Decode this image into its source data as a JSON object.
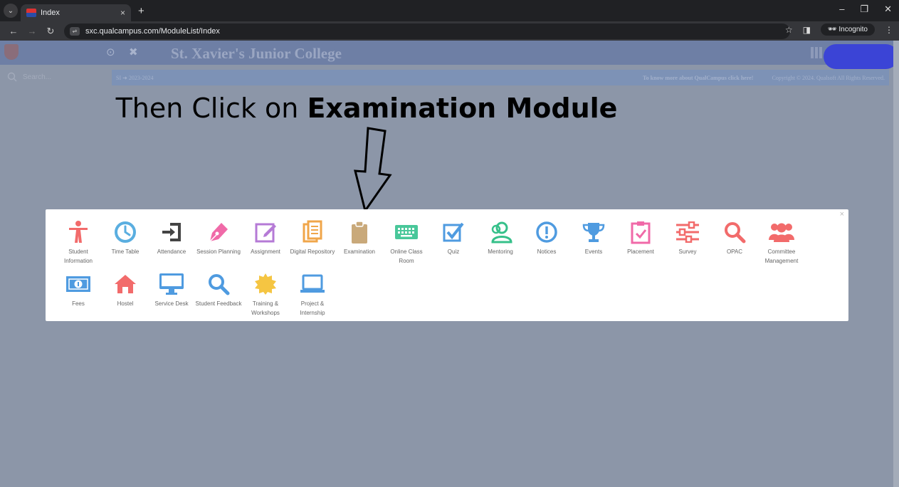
{
  "browser": {
    "tab_title": "Index",
    "tab_close": "×",
    "new_tab": "+",
    "url": "sxc.qualcampus.com/ModuleList/Index",
    "incognito_label": "Incognito",
    "controls": {
      "minimize": "–",
      "restore": "❐",
      "close": "✕"
    }
  },
  "app": {
    "college_name": "St. Xavier's Junior College",
    "search_placeholder": "Search...",
    "info_left": "SI ➜ 2023-2024",
    "info_mid": "To know more about QualCampus click here!",
    "info_right": "Copyright © 2024. Qualsoft All Rights Reserved."
  },
  "instruction": {
    "prefix": "Then Click on ",
    "emphasis": "Examination Module"
  },
  "modal": {
    "close_label": "×",
    "modules": [
      {
        "label": "Student Information",
        "icon": "person-icon",
        "color": "#f26b6b"
      },
      {
        "label": "Time Table",
        "icon": "clock-icon",
        "color": "#5aaee0"
      },
      {
        "label": "Attendance",
        "icon": "door-enter-icon",
        "color": "#444444"
      },
      {
        "label": "Session Planning",
        "icon": "pen-nib-icon",
        "color": "#f06aa8"
      },
      {
        "label": "Assignment",
        "icon": "edit-square-icon",
        "color": "#b57ad6"
      },
      {
        "label": "Digital Repository",
        "icon": "documents-icon",
        "color": "#f0a64a"
      },
      {
        "label": "Examination",
        "icon": "clipboard-icon",
        "color": "#c9a97a"
      },
      {
        "label": "Online Class Room",
        "icon": "keyboard-icon",
        "color": "#49c79a"
      },
      {
        "label": "Quiz",
        "icon": "checkbox-icon",
        "color": "#4f9be0"
      },
      {
        "label": "Mentoring",
        "icon": "people-outline-icon",
        "color": "#36c08a"
      },
      {
        "label": "Notices",
        "icon": "exclamation-circle-icon",
        "color": "#4f9be0"
      },
      {
        "label": "Events",
        "icon": "trophy-icon",
        "color": "#4f9be0"
      },
      {
        "label": "Placement",
        "icon": "clipboard-check-icon",
        "color": "#f06aa8"
      },
      {
        "label": "Survey",
        "icon": "sliders-icon",
        "color": "#f26b6b"
      },
      {
        "label": "OPAC",
        "icon": "search-icon",
        "color": "#f26b6b"
      },
      {
        "label": "Committee Management",
        "icon": "group-icon",
        "color": "#f26b6b"
      },
      {
        "label": "Fees",
        "icon": "money-icon",
        "color": "#4f9be0"
      },
      {
        "label": "Hostel",
        "icon": "home-icon",
        "color": "#f26b6b"
      },
      {
        "label": "Service Desk",
        "icon": "monitor-icon",
        "color": "#4f9be0"
      },
      {
        "label": "Student Feedback",
        "icon": "search-icon",
        "color": "#4f9be0"
      },
      {
        "label": "Training & Workshops",
        "icon": "certificate-icon",
        "color": "#f5c542"
      },
      {
        "label": "Project & Internship",
        "icon": "laptop-icon",
        "color": "#4f9be0"
      }
    ]
  }
}
